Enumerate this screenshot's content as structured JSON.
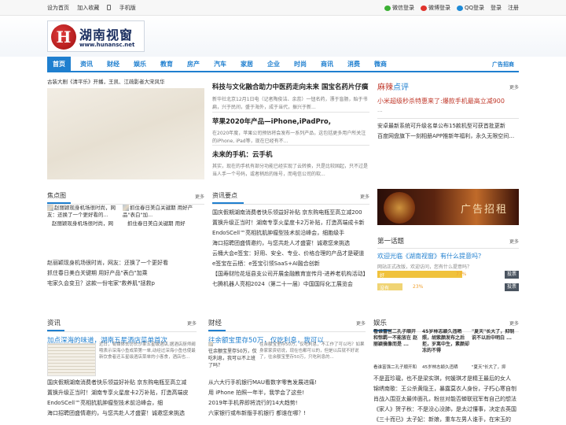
{
  "topbar": {
    "set_home": "设为首页",
    "add_fav": "加入收藏",
    "mobile": "手机版",
    "wechat_login": "微信登录",
    "weibo_login": "微博登录",
    "qq_login": "QQ登录",
    "login": "登录",
    "register": "注册"
  },
  "logo": {
    "mark": "H",
    "name": "湖南视窗",
    "url": "www.hunansc.net"
  },
  "nav": {
    "items": [
      "首页",
      "资讯",
      "财经",
      "娱乐",
      "教育",
      "房产",
      "汽车",
      "家居",
      "企业",
      "时尚",
      "商讯",
      "消费",
      "微商"
    ],
    "ad": "广告招商"
  },
  "colors": {
    "accent": "#1f7fcf",
    "vote_yellow": "#f0c23c",
    "vote_yellow2": "#f0d474",
    "title_red": "#c0392b"
  },
  "hero": {
    "caption": "古装大剧《清平乐》开播，王凯、江疏影者大宋风华",
    "articles": [
      {
        "title": "科技与文化融合助力中医药走向未来 国宝名药片仔癀",
        "summary": "新华社北京12月1日电（记者陶俊洁、余蕊）一钮名药，漂于盲肠，贻于书扁，兴于民间，盛于海外，成于当代，振兴于新..."
      },
      {
        "title": "苹果2020年产品—iPhone,iPadPro,",
        "summary": "在2020年度，苹果公司预估将会发布一系列产品，这包括更多用户所关注的iPhone, iPad等，现在已经有不..."
      },
      {
        "title": "未来的手机：云手机",
        "summary": "其实，现在的手机有部分功能已经实现了云转换，只是比较固起，只不过是当人手一个号码，或者稍后的账号，而电信公司的软..."
      }
    ]
  },
  "pingce": {
    "title_a": "麻辣",
    "title_b": "点评",
    "more": "更多",
    "headline": "小米超级秒杀特惠来了:爆款手机最高立减900",
    "dots": "...",
    "items": [
      "安卓最新系统可升级名单公布15款机型可获首批更新",
      "百度网盘旗下一刻相册APP推新年福利，永久无限空间激活"
    ]
  },
  "focus": {
    "title": "焦点图",
    "more": "更多",
    "cards": [
      {
        "cap": "赵丽颖现身机场很时尚，网友：还换了一个更好看的..."
      },
      {
        "cap": "抓住春日美白关键期 用好产品\"表白\"加..."
      }
    ],
    "subcaps": [
      "赵丽颖现身机场很时尚，网",
      "抓住春日美白关键期 用好"
    ],
    "list": [
      "赵丽颖现身机场很时尚，网友：还换了一个更好看",
      "抓住春日美白关键期 用好产品\"表白\"加乘",
      "宅家久会变丑？这款一份宅家\"救养肌\"拯救p"
    ]
  },
  "zixun_yaodian": {
    "title": "资讯要点",
    "more": "更多",
    "items": [
      "国庆假期湖南消费者快乐领益好补贴 京东购电瓶至高立减200",
      "置换升级正当时！湖南专享火星度卡2万补贴，打造高端成卡新",
      "EndoSCell™亮相抗肌肿瘤型技术前沿峰会，细胞级手",
      "海口招聘团盛情邀约，与您共赴人才盛宴！诚邀您来挑选",
      "云桶大会e签宝：好用、安全、专业、价格合理的产品才是硬道",
      "e签宝在云栖：e签宝引领SaaS+AI融合创新",
      "【国寿财险花垣县支公司开展金融教育宣传月-进养老机构活动】",
      "七腾机器人亮相2024（第二十一届）中国国际化工展览会"
    ]
  },
  "ad_banner": {
    "text": "广告招租"
  },
  "diyihuati": {
    "title": "第一话题",
    "more": "更多",
    "headline": "欢迎光临《湖南视窗》有什么提意吗？",
    "subtitle": "网站正式改版，欢迎访问，您有什么提意吗？",
    "votes": [
      {
        "label": "好",
        "pct_text": "77%",
        "pct": 77,
        "btn": "投票"
      },
      {
        "label": "没有",
        "pct_text": "23%",
        "pct": 23,
        "btn": "投票"
      }
    ]
  },
  "zixun": {
    "title": "资讯",
    "more": "更多",
    "headline": "加点深海的味道，湖南五星酒店菜单首次",
    "summary": "近日，有媒体去访长沙某五星级酒店,据酒店厨师阚哦表示深海小鱼成菜第一单,动经过深海小鱼也使最新饮食者还五星级酒店菜单的小客食，酒店也...",
    "list": [
      "国庆假期湖南消费者快乐领益好补贴 京东购电瓶至高立减",
      "置换升级正当时！湖南专享火星度卡2万补贴，打造高端皮",
      "EndoSCell™亮相抗肌肿瘤型技术前沿峰会，细",
      "海口招聘团盛情邀约，与您共赴人才盛宴！诚邀您来挑选"
    ]
  },
  "caijing": {
    "title": "财经",
    "more": "更多",
    "headline": "往余额宝里存50万，仅吃利息，我可以",
    "col1_cap": "往余额宝里存50万，仅吃利息，我可以不上班了吗？",
    "col2_text": "往余额宝里存50万，仅吃利息，不工作了可以吗？如果身家家资初说，现在也都可以的，但是以后就不好说了，往余额宝里存50万，只吃利息的...",
    "list": [
      "从六大行手机银行MAU看数字零售发展进痛!",
      "用 iPhone 拍照一年半，我学会了这些!",
      "2019年手机界即将流行的14大趋势!",
      "六家银行或布新版手机银行 都谁在哪？!"
    ]
  },
  "yule": {
    "title": "娱乐",
    "more": "更多",
    "cards": [
      {
        "cap": "看谁富宫二孔子顺开和惊羁一不能放在 赵丽颖搞像而是 ..."
      },
      {
        "cap": "45岁林志颖久违晒照，胡紫颜发布之后拒，岁离中生，素颜却冻的不得"
      },
      {
        "cap": "\"夏天\"长大了，抑制说不以后中明白 ..."
      }
    ],
    "subcaps": [
      "看谁富强二孔子顺开和",
      "45岁林志颖久违晒",
      "\"夏天\"长大了，抑"
    ],
    "list": [
      "不是蓝珍瓏，也不是梁实琪，何媛琪才是精王最后的女人",
      "锦绣南歌：王公杀黄隐王，暴露莫衣人身份，子朽心寒自刎",
      "肖战入围亚太最帅面孔，粉丝对能否蝉联冠军有自己的想法",
      "《家人》贺子秋：不是没心没肺，是太过懂事，决定去英国",
      "《三十而已》太子妃：新娘，重车左男人谁手，在宋玉的"
    ]
  }
}
